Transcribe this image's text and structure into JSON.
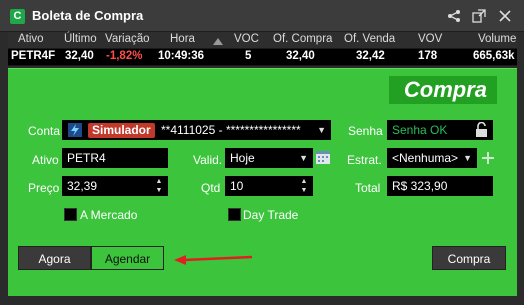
{
  "window": {
    "title": "Boleta de Compra",
    "app_icon": "C"
  },
  "quote": {
    "headers": [
      "Ativo",
      "Último",
      "Variação",
      "Hora",
      "",
      "VOC",
      "Of. Compra",
      "Of. Venda",
      "VOV",
      "Volume"
    ],
    "values": [
      "PETR4F",
      "32,40",
      "-1,82%",
      "10:49:36",
      "",
      "5",
      "32,40",
      "32,42",
      "178",
      "665,63k"
    ],
    "negative_color": "#ff4d4d"
  },
  "banner": {
    "label": "Compra"
  },
  "form": {
    "conta_label": "Conta",
    "conta_badge": "Simulador",
    "conta_value": "**4111025 - ****************",
    "senha_label": "Senha",
    "senha_value": "Senha OK",
    "ativo_label": "Ativo",
    "ativo_value": "PETR4",
    "valid_label": "Valid.",
    "valid_value": "Hoje",
    "estrat_label": "Estrat.",
    "estrat_value": "<Nenhuma>",
    "preco_label": "Preço",
    "preco_value": "32,39",
    "qtd_label": "Qtd",
    "qtd_value": "10",
    "total_label": "Total",
    "total_value": "R$ 323,90",
    "a_mercado_label": "A Mercado",
    "day_trade_label": "Day Trade"
  },
  "buttons": {
    "agora": "Agora",
    "agendar": "Agendar",
    "compra": "Compra"
  },
  "colors": {
    "green": "#3cc43c",
    "dark_green": "#22a022",
    "accent_red": "#e02020"
  }
}
